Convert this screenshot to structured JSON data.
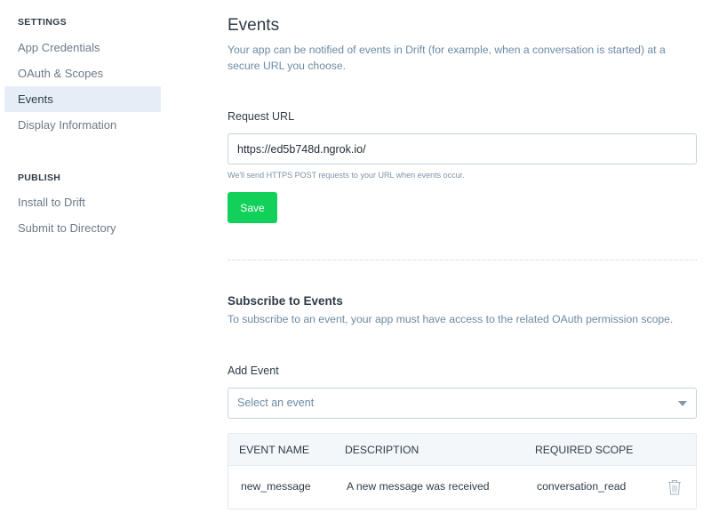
{
  "sidebar": {
    "settings_heading": "SETTINGS",
    "settings_items": [
      {
        "label": "App Credentials",
        "active": false
      },
      {
        "label": "OAuth & Scopes",
        "active": false
      },
      {
        "label": "Events",
        "active": true
      },
      {
        "label": "Display Information",
        "active": false
      }
    ],
    "publish_heading": "PUBLISH",
    "publish_items": [
      {
        "label": "Install to Drift"
      },
      {
        "label": "Submit to Directory"
      }
    ]
  },
  "main": {
    "title": "Events",
    "description": "Your app can be notified of events in Drift (for example, when a conversation is started) at a secure URL you choose.",
    "request_url": {
      "label": "Request URL",
      "value": "https://ed5b748d.ngrok.io/",
      "helper": "We'll send HTTPS POST requests to your URL when events occur."
    },
    "save_label": "Save",
    "subscribe": {
      "title": "Subscribe to Events",
      "description": "To subscribe to an event, your app must have access to the related OAuth permission scope.",
      "add_event_label": "Add Event",
      "select_placeholder": "Select an event"
    },
    "table": {
      "headers": [
        "EVENT NAME",
        "DESCRIPTION",
        "REQUIRED SCOPE"
      ],
      "rows": [
        {
          "event_name": "new_message",
          "description": "A new message was received",
          "required_scope": "conversation_read"
        }
      ]
    }
  },
  "colors": {
    "accent_green": "#12d15a",
    "active_nav_bg": "#e5eef7",
    "muted_text": "#6c8aa3"
  },
  "icons": {
    "delete": "trash-icon",
    "dropdown": "chevron-down-icon"
  }
}
